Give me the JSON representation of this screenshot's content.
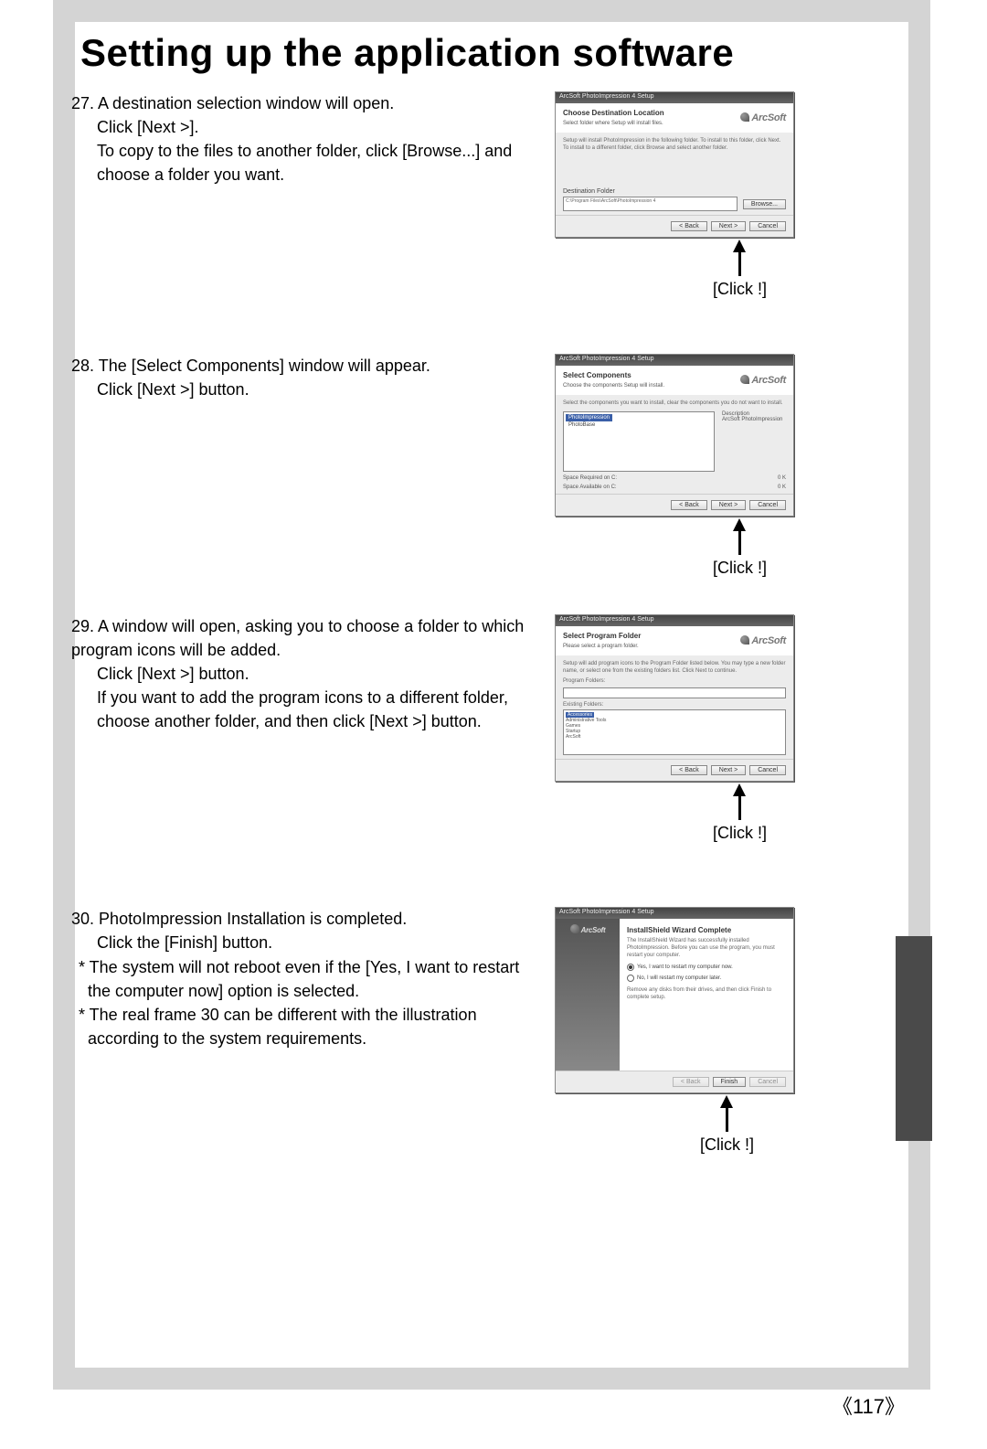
{
  "page": {
    "title": "Setting up the application software",
    "number": "117"
  },
  "steps": [
    {
      "num": "27.",
      "lines": [
        "A destination selection window will open.",
        "Click [Next >].",
        "To copy to the files to another folder, click [Browse...] and choose a folder you want."
      ]
    },
    {
      "num": "28.",
      "lines": [
        "The [Select Components] window will appear.",
        "Click [Next >] button."
      ]
    },
    {
      "num": "29.",
      "lines": [
        "A window will open, asking you to choose a folder to which program icons will be added.",
        "Click [Next >] button.",
        "If you want to add the program icons to a different folder, choose another folder, and then click [Next >] button."
      ]
    },
    {
      "num": "30.",
      "lines": [
        "PhotoImpression Installation is completed.",
        "Click the [Finish] button."
      ],
      "notes": [
        "* The system will not reboot even if the [Yes, I want to restart the computer now] option is selected.",
        "* The real frame 30 can be different with the illustration according to the system requirements."
      ]
    }
  ],
  "click_label": "[Click !]",
  "dialogs": {
    "d27": {
      "titlebar": "ArcSoft PhotoImpression 4 Setup",
      "header": "Choose Destination Location",
      "sub": "Select folder where Setup will install files.",
      "body": "Setup will install PhotoImpression in the following folder. To install to this folder, click Next. To install to a different folder, click Browse and select another folder.",
      "dest_label": "Destination Folder",
      "dest_path": "C:\\Program Files\\ArcSoft\\PhotoImpression 4",
      "browse": "Browse...",
      "back": "< Back",
      "next": "Next >",
      "cancel": "Cancel",
      "brand": "ArcSoft"
    },
    "d28": {
      "titlebar": "ArcSoft PhotoImpression 4 Setup",
      "header": "Select Components",
      "sub": "Choose the components Setup will install.",
      "body": "Select the components you want to install, clear the components you do not want to install.",
      "item1": "PhotoImpression",
      "item2": "PhotoBase",
      "desc_label": "Description",
      "desc": "ArcSoft PhotoImpression",
      "space1": "Space Required on C:",
      "space1v": "0 K",
      "space2": "Space Available on C:",
      "space2v": "0 K",
      "back": "< Back",
      "next": "Next >",
      "cancel": "Cancel",
      "brand": "ArcSoft"
    },
    "d29": {
      "titlebar": "ArcSoft PhotoImpression 4 Setup",
      "header": "Select Program Folder",
      "sub": "Please select a program folder.",
      "body": "Setup will add program icons to the Program Folder listed below. You may type a new folder name, or select one from the existing folders list. Click Next to continue.",
      "prog_label": "Program Folders:",
      "exist_label": "Existing Folders:",
      "folders": [
        "Accessories",
        "Administrative Tools",
        "Games",
        "Startup",
        "ArcSoft"
      ],
      "back": "< Back",
      "next": "Next >",
      "cancel": "Cancel",
      "brand": "ArcSoft"
    },
    "d30": {
      "titlebar": "ArcSoft PhotoImpression 4 Setup",
      "header": "InstallShield Wizard Complete",
      "body": "The InstallShield Wizard has successfully installed PhotoImpression. Before you can use the program, you must restart your computer.",
      "opt1": "Yes, I want to restart my computer now.",
      "opt2": "No, I will restart my computer later.",
      "tail": "Remove any disks from their drives, and then click Finish to complete setup.",
      "finish": "Finish",
      "cancel": "Cancel",
      "back": "< Back",
      "brand": "ArcSoft"
    }
  }
}
